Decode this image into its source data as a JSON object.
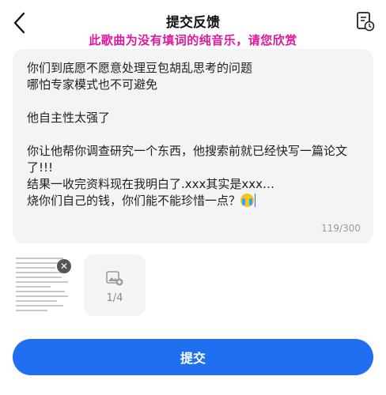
{
  "header": {
    "title": "提交反馈",
    "back_icon": "chevron-left-icon",
    "history_icon": "feedback-history-icon"
  },
  "overlay_caption": "此歌曲为没有填词的纯音乐，请您欣赏",
  "feedback": {
    "lines": [
      "你们到底愿不愿意处理豆包胡乱思考的问题",
      "哪怕专家模式也不可避免",
      "",
      "他自主性太强了",
      "",
      "你让他帮你调查研究一个东西，他搜索前就已经快写一篇论文",
      "了!!!",
      "结果一收完资料现在我明白了.xxx其实是xxx…",
      "烧你们自己的钱，你们能不能珍惜一点？"
    ],
    "emoji": "crying-face-emoji",
    "counter": "119/300"
  },
  "attachments": {
    "thumbnail_icon": "remove-icon",
    "add_image_icon": "add-image-icon",
    "count": "1/4"
  },
  "submit_label": "提交",
  "colors": {
    "accent": "#1f6ff0",
    "overlay_text": "#e0179b",
    "field_bg": "#f4f4f6"
  }
}
